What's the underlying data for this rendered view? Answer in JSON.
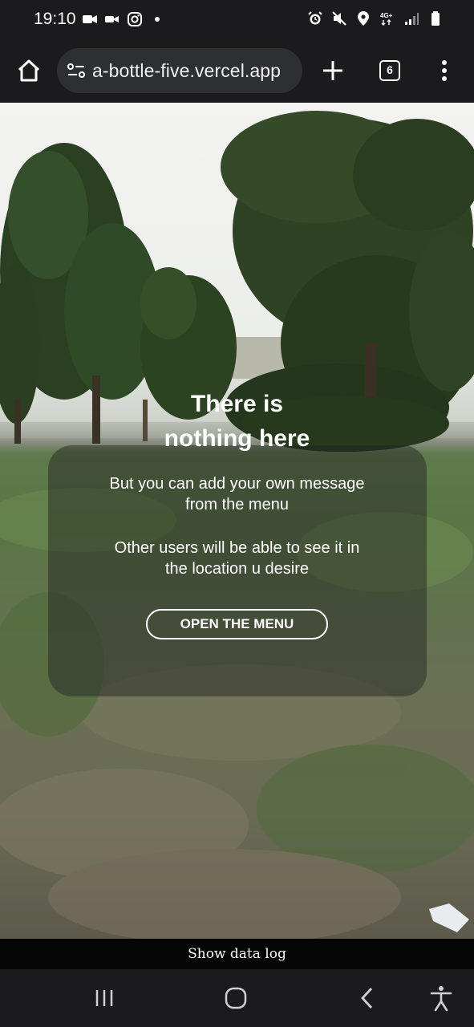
{
  "status_bar": {
    "time": "19:10",
    "left_icons": [
      "video-call-icon",
      "camera-icon",
      "instagram-icon",
      "dot-icon"
    ],
    "right_icons": [
      "alarm-icon",
      "mute-icon",
      "location-icon",
      "network-4g-icon",
      "signal-icon",
      "battery-icon"
    ]
  },
  "browser": {
    "url": "a-bottle-five.vercel.app",
    "tab_count": "6",
    "icons": [
      "home-icon",
      "site-info-icon",
      "plus-icon",
      "tab-switcher-icon",
      "more-vert-icon"
    ]
  },
  "message": {
    "title_line1": "There is",
    "title_line2": "nothing here",
    "line1": "But you can add your own message",
    "line2": "from the menu",
    "line3": "Other users will be able to see it in",
    "line4": "the location u desire",
    "button_label": "OPEN THE MENU"
  },
  "footer": {
    "data_log_label": "Show data log"
  },
  "nav": {
    "icons": [
      "recents-icon",
      "home-circle-icon",
      "back-icon",
      "accessibility-icon"
    ]
  }
}
